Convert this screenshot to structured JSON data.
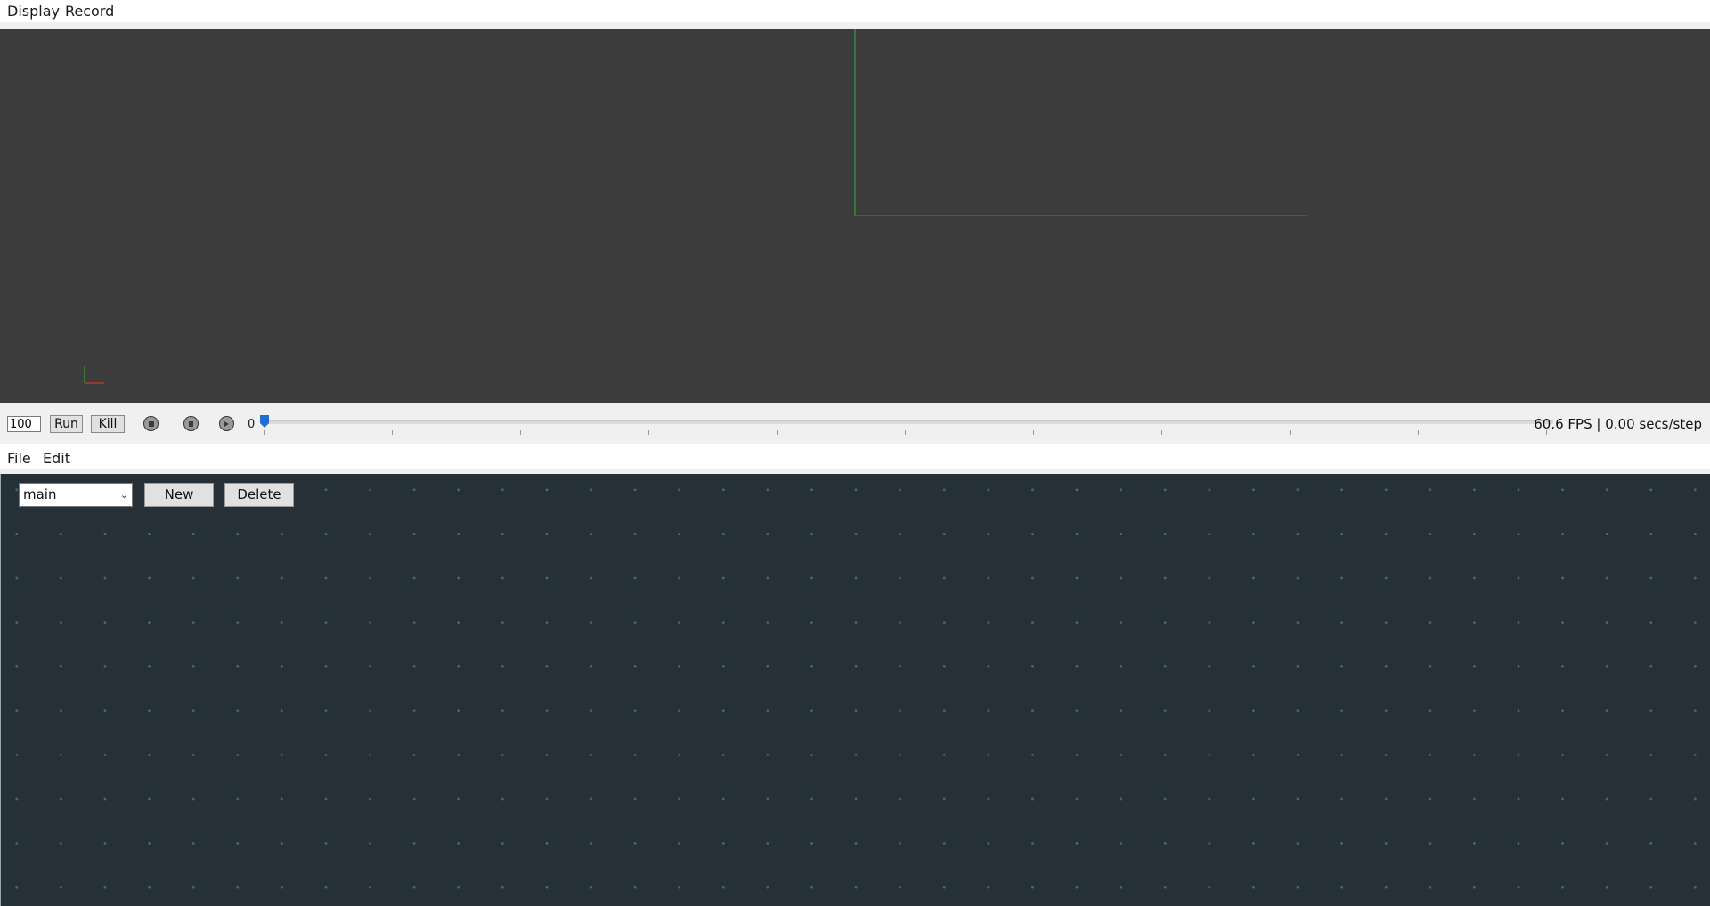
{
  "viewer_menu": {
    "display": "Display",
    "record": "Record"
  },
  "controls": {
    "steps_value": "100",
    "run_label": "Run",
    "kill_label": "Kill",
    "step_counter": "0",
    "timeline_position": 0,
    "status": "60.6 FPS | 0.00 secs/step"
  },
  "editor_menu": {
    "file": "File",
    "edit": "Edit"
  },
  "editor": {
    "graph_select": "main",
    "new_label": "New",
    "delete_label": "Delete"
  },
  "colors": {
    "viewport_bg": "#3c3c3c",
    "editor_bg": "#263038",
    "axis_x": "#b03a2e",
    "axis_y": "#3a8a3a",
    "slider_accent": "#1f6fd0"
  }
}
